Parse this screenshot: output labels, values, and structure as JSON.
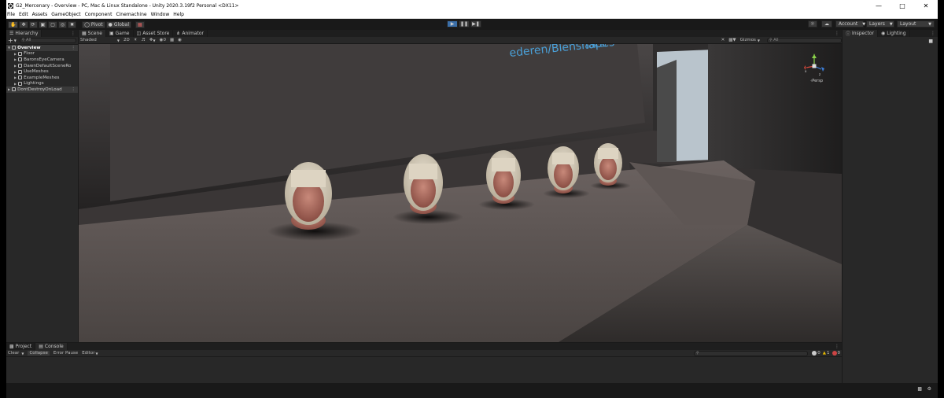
{
  "window": {
    "title": "G2_Mercenary - Overview - PC, Mac & Linux Standalone - Unity 2020.3.19f2 Personal <DX11>"
  },
  "menu": [
    "File",
    "Edit",
    "Assets",
    "GameObject",
    "Component",
    "Cinemachine",
    "Window",
    "Help"
  ],
  "toolbar": {
    "pivot": "Pivot",
    "global": "Global",
    "account": "Account",
    "layers": "Layers",
    "layout": "Layout"
  },
  "hierarchy": {
    "tab": "Hierarchy",
    "search_placeholder": "All",
    "items": [
      "Overview",
      "Floor",
      "BaronsEyeCamera",
      "DawnDefaultSceneRo",
      "UseMeshes",
      "ExampleMeshes",
      "Lightings",
      "DontDestroyOnLoad"
    ]
  },
  "scene_tabs": [
    "Scene",
    "Game",
    "Asset Store",
    "Animator"
  ],
  "scene_toolbar": {
    "shading": "Shaded",
    "mode2d": "2D",
    "fx_count": "0",
    "gizmos": "Gizmos",
    "search_placeholder": "All"
  },
  "viewport": {
    "banner": "ederen/Blenshapes",
    "banner2": "ook.at",
    "persp": "Persp",
    "axis_y": "y",
    "axis_x": "x",
    "axis_z": "z"
  },
  "inspector": {
    "tab1": "Inspector",
    "tab2": "Lighting"
  },
  "bottom": {
    "tab1": "Project",
    "tab2": "Console",
    "clear": "Clear",
    "collapse": "Collapse",
    "error_pause": "Error Pause",
    "editor": "Editor",
    "count_log": "0",
    "count_warn": "1",
    "count_err": "0"
  },
  "colors": {
    "accent_play": "#3b6fa8",
    "editor_bg": "#282828",
    "toolbar_bg": "#191919"
  }
}
